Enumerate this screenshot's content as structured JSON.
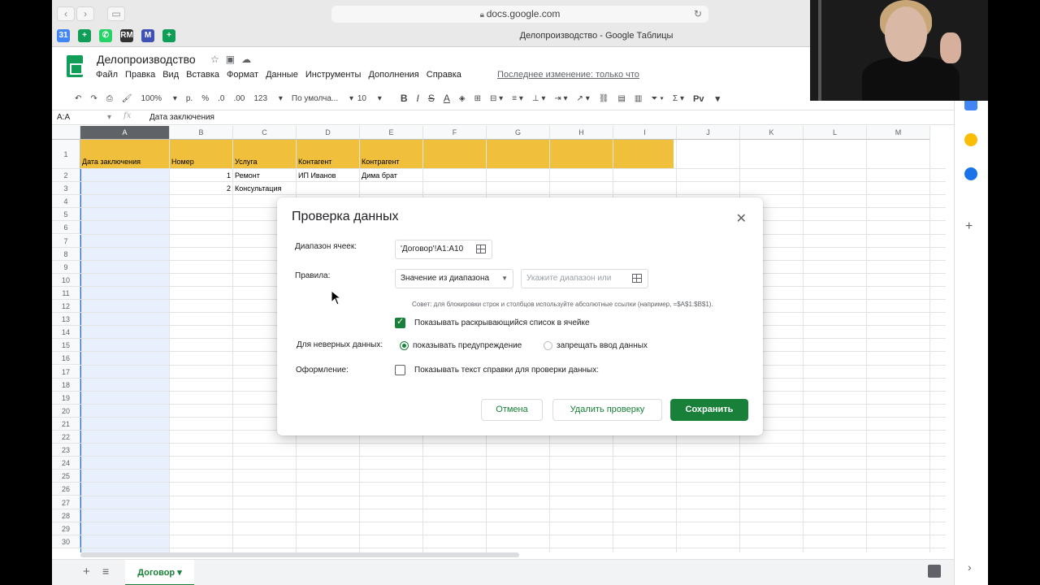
{
  "browser": {
    "url": "docs.google.com",
    "window_title": "Делопроизводство - Google Таблицы",
    "back": "‹",
    "forward": "›",
    "reload_icon": "↻"
  },
  "bookmarks": [
    {
      "name": "calendar-icon",
      "label": "31",
      "color": "#4285f4"
    },
    {
      "name": "sheets-icon",
      "label": "+",
      "color": "#0f9d58"
    },
    {
      "name": "whatsapp-icon",
      "label": "✆",
      "color": "#25d366"
    },
    {
      "name": "rm-icon",
      "label": "RM",
      "color": "#333333"
    },
    {
      "name": "mail-icon",
      "label": "M",
      "color": "#3f51b5"
    },
    {
      "name": "sheets-icon-2",
      "label": "+",
      "color": "#0f9d58"
    }
  ],
  "doc": {
    "title": "Делопроизводство",
    "menu": [
      "Файл",
      "Правка",
      "Вид",
      "Вставка",
      "Формат",
      "Данные",
      "Инструменты",
      "Дополнения",
      "Справка"
    ],
    "last_edit": "Последнее изменение: только что"
  },
  "toolbar": {
    "zoom": "100%",
    "currency": "р.",
    "percent": "%",
    "dec_less": ".0",
    "dec_more": ".00",
    "format_more": "123",
    "font": "По умолча...",
    "size": "10",
    "bold": "B",
    "italic": "I",
    "strike": "S",
    "text_color": "A",
    "input_tools": "Рv"
  },
  "formula_bar": {
    "name_box": "A:A",
    "fx": "fx",
    "value": "Дата заключения"
  },
  "grid": {
    "columns": [
      "A",
      "B",
      "C",
      "D",
      "E",
      "F",
      "G",
      "H",
      "I",
      "J",
      "K",
      "L",
      "M"
    ],
    "rows": [
      "1",
      "2",
      "3",
      "4",
      "5",
      "6",
      "7",
      "8",
      "9",
      "10",
      "11",
      "12",
      "13",
      "14",
      "15",
      "16",
      "17",
      "18",
      "19",
      "20",
      "21",
      "22",
      "23",
      "24",
      "25",
      "26",
      "27",
      "28",
      "29",
      "30"
    ],
    "header_row": [
      "Дата заключения",
      "Номер",
      "Услуга",
      "Контагент",
      "Контрагент"
    ],
    "data": [
      {
        "num": "1",
        "service": "Ремонт",
        "contagent": "ИП Иванов",
        "contractor": "Дима брат"
      },
      {
        "num": "2",
        "service": "Консультация",
        "contagent": "",
        "contractor": ""
      }
    ]
  },
  "dialog": {
    "title": "Проверка данных",
    "range_label": "Диапазон ячеек:",
    "range_value": "'Договор'!A1:A10",
    "rules_label": "Правила:",
    "rule_type": "Значение из диапазона",
    "rule_range_placeholder": "Укажите диапазон или",
    "hint": "Совет: для блокировки строк и столбцов используйте абсолютные ссылки (например, =$A$1:$B$1).",
    "show_dropdown": "Показывать раскрывающийся список в ячейке",
    "invalid_label": "Для неверных данных:",
    "opt_warn": "показывать предупреждение",
    "opt_reject": "запрещать ввод данных",
    "appearance_label": "Оформление:",
    "show_help": "Показывать текст справки для проверки данных:",
    "cancel": "Отмена",
    "delete": "Удалить проверку",
    "save": "Сохранить"
  },
  "sheet_tab": "Договор",
  "colors": {
    "accent": "#188038",
    "header_fill": "#f0bf3c",
    "selection": "#e8f0fe"
  }
}
